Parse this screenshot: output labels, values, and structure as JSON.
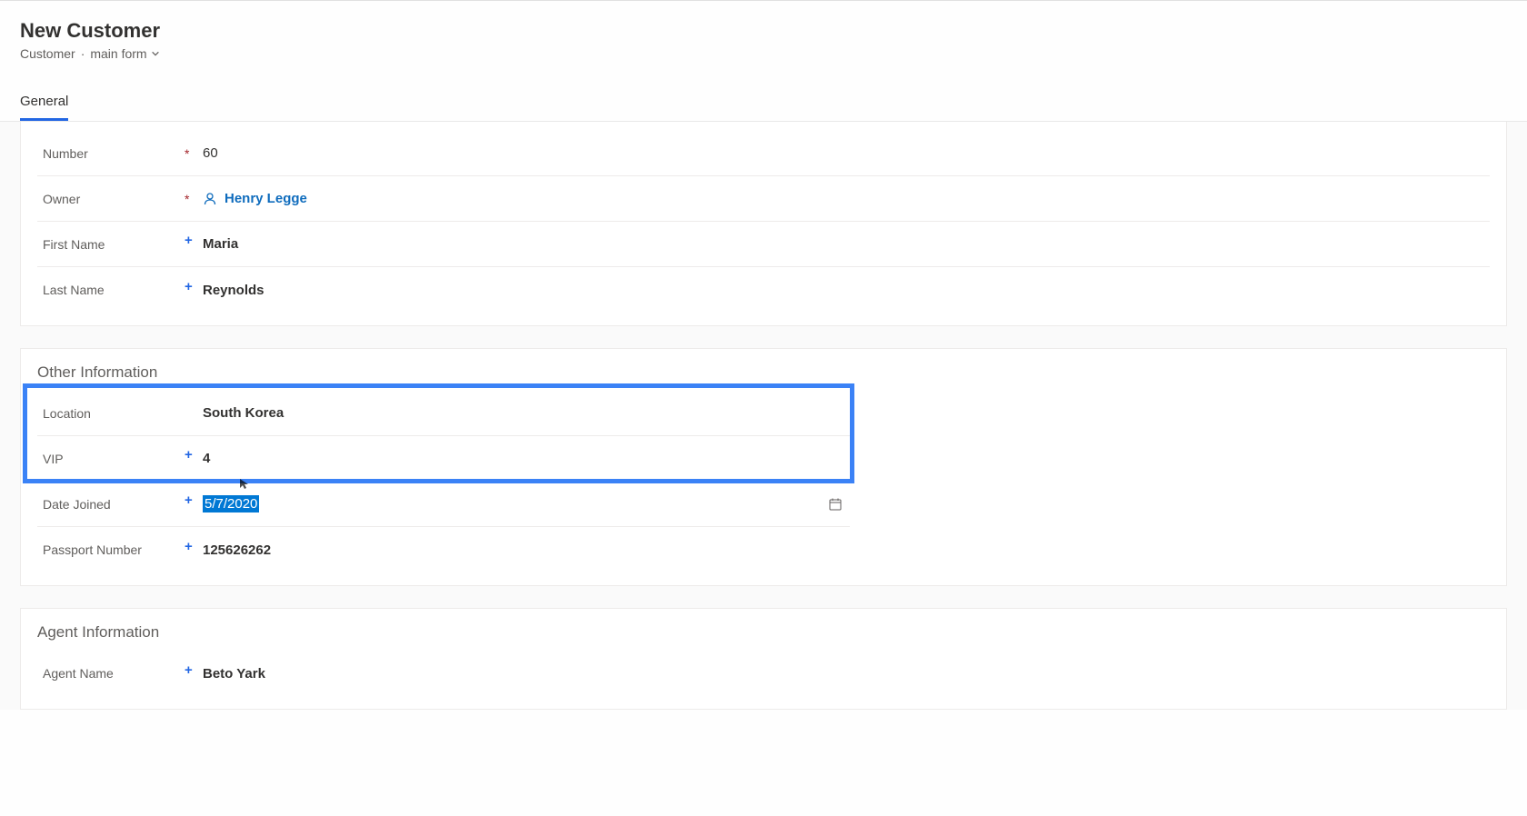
{
  "header": {
    "title": "New Customer",
    "entity": "Customer",
    "form_name": "main form"
  },
  "tabs": [
    {
      "label": "General"
    }
  ],
  "primary_fields": {
    "number": {
      "label": "Number",
      "value": "60",
      "indicator": "*"
    },
    "owner": {
      "label": "Owner",
      "value": "Henry Legge",
      "indicator": "*"
    },
    "first_name": {
      "label": "First Name",
      "value": "Maria",
      "indicator": "+"
    },
    "last_name": {
      "label": "Last Name",
      "value": "Reynolds",
      "indicator": "+"
    }
  },
  "other_info": {
    "title": "Other Information",
    "location": {
      "label": "Location",
      "value": "South Korea",
      "indicator": ""
    },
    "vip": {
      "label": "VIP",
      "value": "4",
      "indicator": "+"
    },
    "date_joined": {
      "label": "Date Joined",
      "value": "5/7/2020",
      "indicator": "+"
    },
    "passport_number": {
      "label": "Passport Number",
      "value": "125626262",
      "indicator": "+"
    }
  },
  "agent_info": {
    "title": "Agent Information",
    "agent_name": {
      "label": "Agent Name",
      "value": "Beto Yark",
      "indicator": "+"
    }
  }
}
